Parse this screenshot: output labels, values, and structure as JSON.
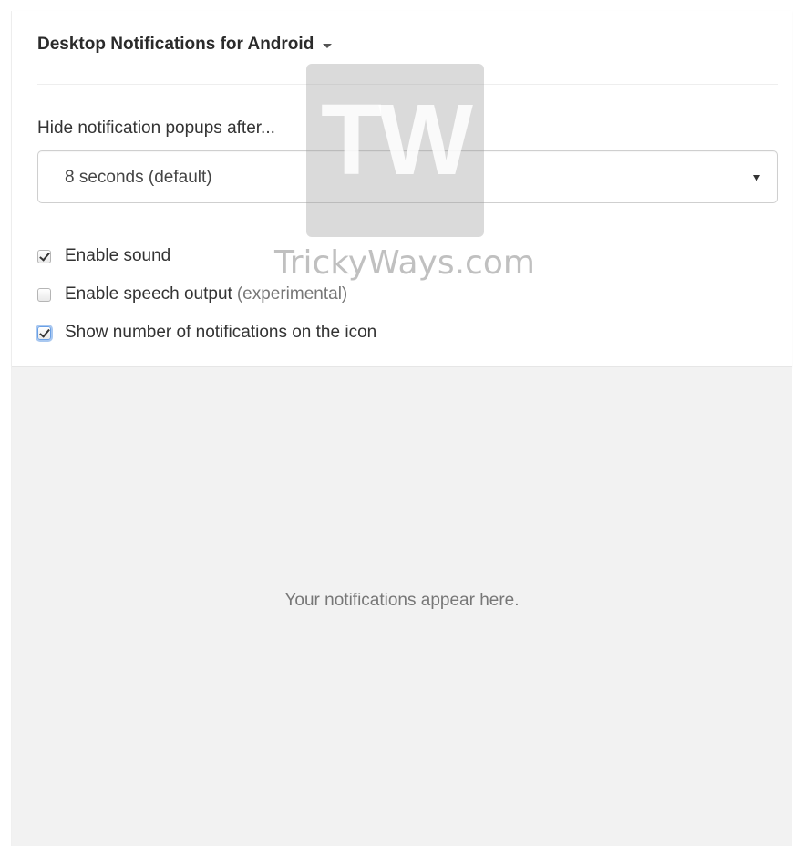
{
  "header": {
    "title": "Desktop Notifications for Android"
  },
  "settings": {
    "hide_label": "Hide notification popups after...",
    "select_value": "8 seconds (default)",
    "checkboxes": [
      {
        "label": "Enable sound",
        "note": "",
        "checked": true
      },
      {
        "label": "Enable speech output",
        "note": "(experimental)",
        "checked": false
      },
      {
        "label": "Show number of notifications on the icon",
        "note": "",
        "checked": true
      }
    ]
  },
  "empty_state": {
    "message": "Your notifications appear here."
  },
  "watermark": {
    "logo": "TW",
    "site": "TrickyWays.com"
  },
  "colors": {
    "empty_background": "#f2f2f2",
    "focus_ring": "#a9c8f0"
  }
}
